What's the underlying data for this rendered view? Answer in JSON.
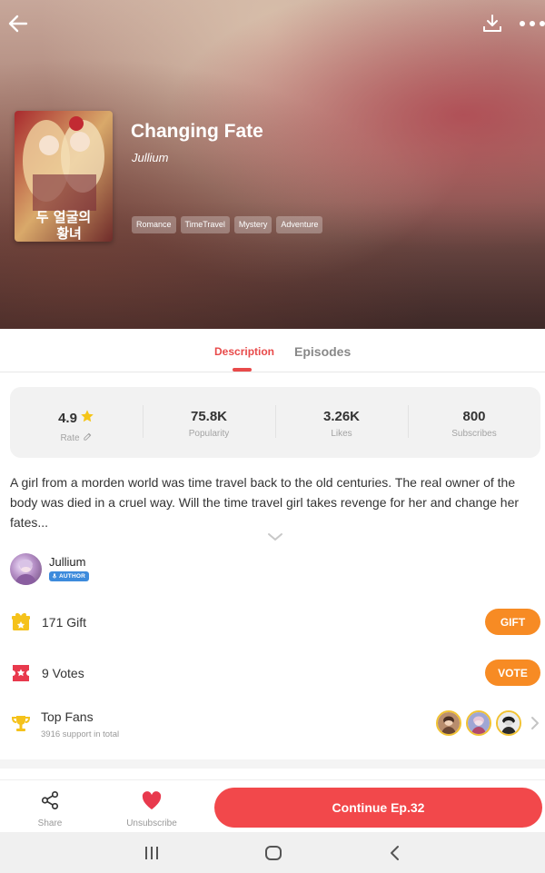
{
  "header": {
    "icons": {
      "back": "arrow-left-icon",
      "download": "download-icon",
      "more": "more-dots-icon"
    }
  },
  "comic": {
    "title": "Changing Fate",
    "author": "Jullium",
    "tags": [
      "Romance",
      "TimeTravel",
      "Mystery",
      "Adventure"
    ],
    "cover_text": "두 얼굴의 황녀"
  },
  "tabs": {
    "description": "Description",
    "episodes": "Episodes",
    "active": "Description"
  },
  "stats": {
    "rate": {
      "value": "4.9",
      "label": "Rate"
    },
    "popularity": {
      "value": "75.8K",
      "label": "Popularity"
    },
    "likes": {
      "value": "3.26K",
      "label": "Likes"
    },
    "subscribes": {
      "value": "800",
      "label": "Subscribes"
    }
  },
  "description": {
    "text": "A girl from a morden world was time travel back to the old centuries. The real owner of the body was died in a cruel way. Will the time travel girl takes revenge for her and change her fates..."
  },
  "author": {
    "name": "Jullium",
    "badge": "AUTHOR"
  },
  "gift": {
    "count_text": "171 Gift",
    "button": "GIFT"
  },
  "vote": {
    "count_text": "9 Votes",
    "button": "VOTE"
  },
  "fans": {
    "title": "Top Fans",
    "subtitle": "3916 support in total"
  },
  "actions": {
    "share": "Share",
    "unsubscribe": "Unsubscribe",
    "continue": "Continue Ep.32"
  },
  "colors": {
    "accent": "#e84a4a",
    "continue_button": "#f2484b",
    "pill_orange": "#f78b24",
    "heart": "#e8394d"
  }
}
